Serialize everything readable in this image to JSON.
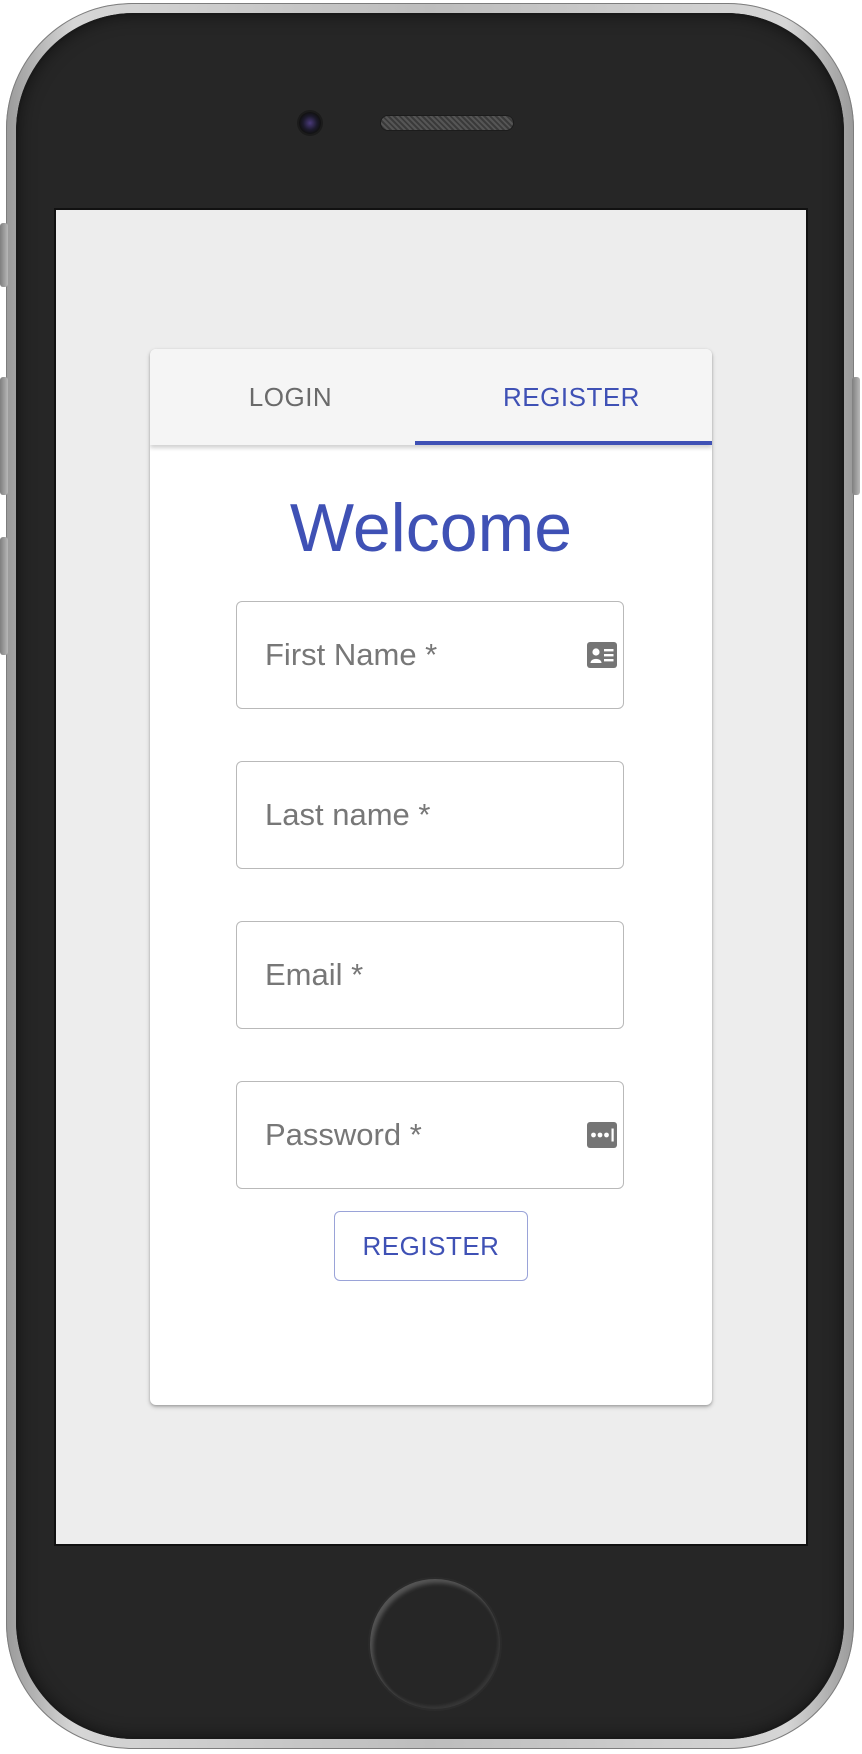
{
  "tabs": [
    {
      "label": "LOGIN",
      "active": false
    },
    {
      "label": "REGISTER",
      "active": true
    }
  ],
  "form": {
    "title": "Welcome",
    "fields": [
      {
        "placeholder": "First Name *",
        "icon": "contact-card-icon"
      },
      {
        "placeholder": "Last name *"
      },
      {
        "placeholder": "Email *"
      },
      {
        "placeholder": "Password *",
        "icon": "password-dots-icon"
      }
    ],
    "submit_label": "REGISTER"
  },
  "colors": {
    "primary": "#3f51b5",
    "screen_background": "#ededed",
    "card_background": "#ffffff",
    "tab_bar": "#f5f5f5",
    "inactive_tab_text": "#6a6a6a",
    "placeholder_text": "#777777",
    "field_border": "#b9b9b9",
    "icon_gray": "#757575",
    "device_body": "#262626"
  }
}
